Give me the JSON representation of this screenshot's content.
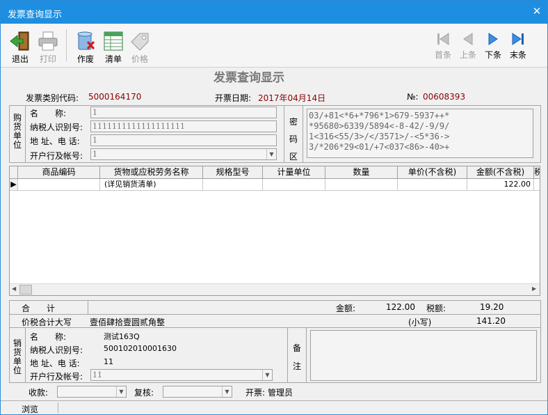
{
  "window": {
    "title": "发票查询显示",
    "close": "✕"
  },
  "toolbar": {
    "exit": "退出",
    "print": "打印",
    "void": "作废",
    "list": "清单",
    "price": "价格",
    "first": "首条",
    "prev": "上条",
    "next": "下条",
    "last": "末条"
  },
  "form_title": "发票查询显示",
  "header": {
    "type_code_label": "发票类别代码:",
    "type_code": "5000164170",
    "date_label": "开票日期:",
    "date": "2017年04月14日",
    "no_label": "№:",
    "no": "00608393"
  },
  "buyer": {
    "section_label": [
      "购",
      "货",
      "单",
      "位"
    ],
    "name_label": "名　　称:",
    "name": "1",
    "tax_id_label": "纳税人识别号:",
    "tax_id": "1111111111111111111",
    "addr_label": "地 址、电 话:",
    "addr": "1",
    "bank_label": "开户行及帐号:",
    "bank": "1"
  },
  "cipher": {
    "label": [
      "密",
      "码",
      "区"
    ],
    "lines": [
      "03/+81<*6+*796*1>679-5937++*",
      "*95680>6339/5894<-8-42/-9/9/",
      "1<316<55/3>/</3571>/-<5*36->",
      "3/*206*29<01/+7<037<86>-40>+"
    ]
  },
  "grid": {
    "headers": [
      "商品编码",
      "货物或应税劳务名称",
      "规格型号",
      "计量单位",
      "数量",
      "单价(不含税)",
      "金额(不含税)",
      "税"
    ],
    "row": {
      "code": "",
      "name": "(详见销货清单)",
      "spec": "",
      "unit": "",
      "qty": "",
      "price": "",
      "amount": "122.00"
    }
  },
  "totals": {
    "label": "合　　计",
    "amount_label": "金额:",
    "amount": "122.00",
    "tax_label": "税额:",
    "tax": "19.20",
    "upper_label": "价税合计大写",
    "upper": "壹佰肆拾壹圆贰角整",
    "lower_label": "(小写)",
    "lower": "141.20"
  },
  "seller": {
    "section_label": [
      "销",
      "货",
      "单",
      "位"
    ],
    "name_label": "名　　称:",
    "name": "测试163Q",
    "tax_id_label": "纳税人识别号:",
    "tax_id": "500102010001630",
    "addr_label": "地 址、电 话:",
    "addr": "11",
    "bank_label": "开户行及帐号:",
    "bank": "11"
  },
  "remark": {
    "label": [
      "备",
      "注"
    ]
  },
  "footer": {
    "payee_label": "收款:",
    "reviewer_label": "复核:",
    "issuer_label": "开票:",
    "issuer": "管理员"
  },
  "status": {
    "mode": "浏览"
  }
}
